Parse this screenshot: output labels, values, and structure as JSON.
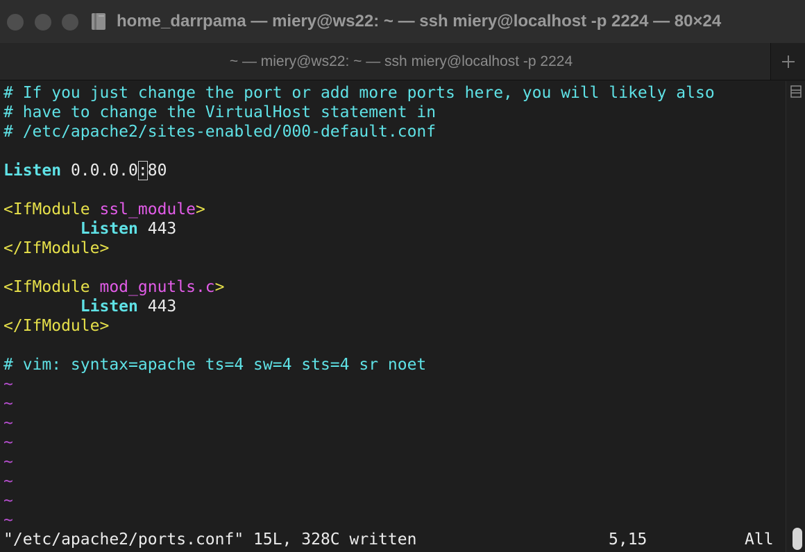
{
  "window": {
    "title": "home_darrpama — miery@ws22: ~ — ssh miery@localhost -p 2224 — 80×24",
    "icons": {
      "traffic_lights": [
        "close-icon",
        "minimize-icon",
        "zoom-icon"
      ],
      "title_icon": "folder-icon"
    }
  },
  "tabbar": {
    "active_tab_label": "~ — miery@ws22: ~ — ssh miery@localhost -p 2224",
    "new_tab_icon": "plus-icon"
  },
  "editor": {
    "lines": {
      "comment_1": "# If you just change the port or add more ports here, you will likely also",
      "comment_2": "# have to change the VirtualHost statement in",
      "comment_3": "# /etc/apache2/sites-enabled/000-default.conf",
      "listen_keyword": "Listen",
      "listen_value_before_cursor": " 0.0.0.0",
      "cursor_char": ":",
      "listen_value_after_cursor": "80",
      "ifmodule1_open_tag": "<IfModule ",
      "ifmodule1_name": "ssl_module",
      "ifmodule1_open_close": ">",
      "ifmodule1_indent": "        ",
      "ifmodule1_listen_keyword": "Listen",
      "ifmodule1_listen_value": " 443",
      "ifmodule1_close_tag": "</IfModule>",
      "ifmodule2_open_tag": "<IfModule ",
      "ifmodule2_name": "mod_gnutls.c",
      "ifmodule2_open_close": ">",
      "ifmodule2_indent": "        ",
      "ifmodule2_listen_keyword": "Listen",
      "ifmodule2_listen_value": " 443",
      "ifmodule2_close_tag": "</IfModule>",
      "modeline": "# vim: syntax=apache ts=4 sw=4 sts=4 sr noet"
    },
    "empty_marker": "~"
  },
  "statusline": {
    "message": "\"/etc/apache2/ports.conf\" 15L, 328C written",
    "cursor_position": "5,15",
    "scroll_position": "All"
  },
  "colors": {
    "comment": "#5fe2e6",
    "keyword": "#5fe2e6",
    "tag": "#e6e04a",
    "module_name": "#e25ce8",
    "tilde": "#b74fd0",
    "text": "#ececec",
    "background": "#1e1e1e"
  }
}
